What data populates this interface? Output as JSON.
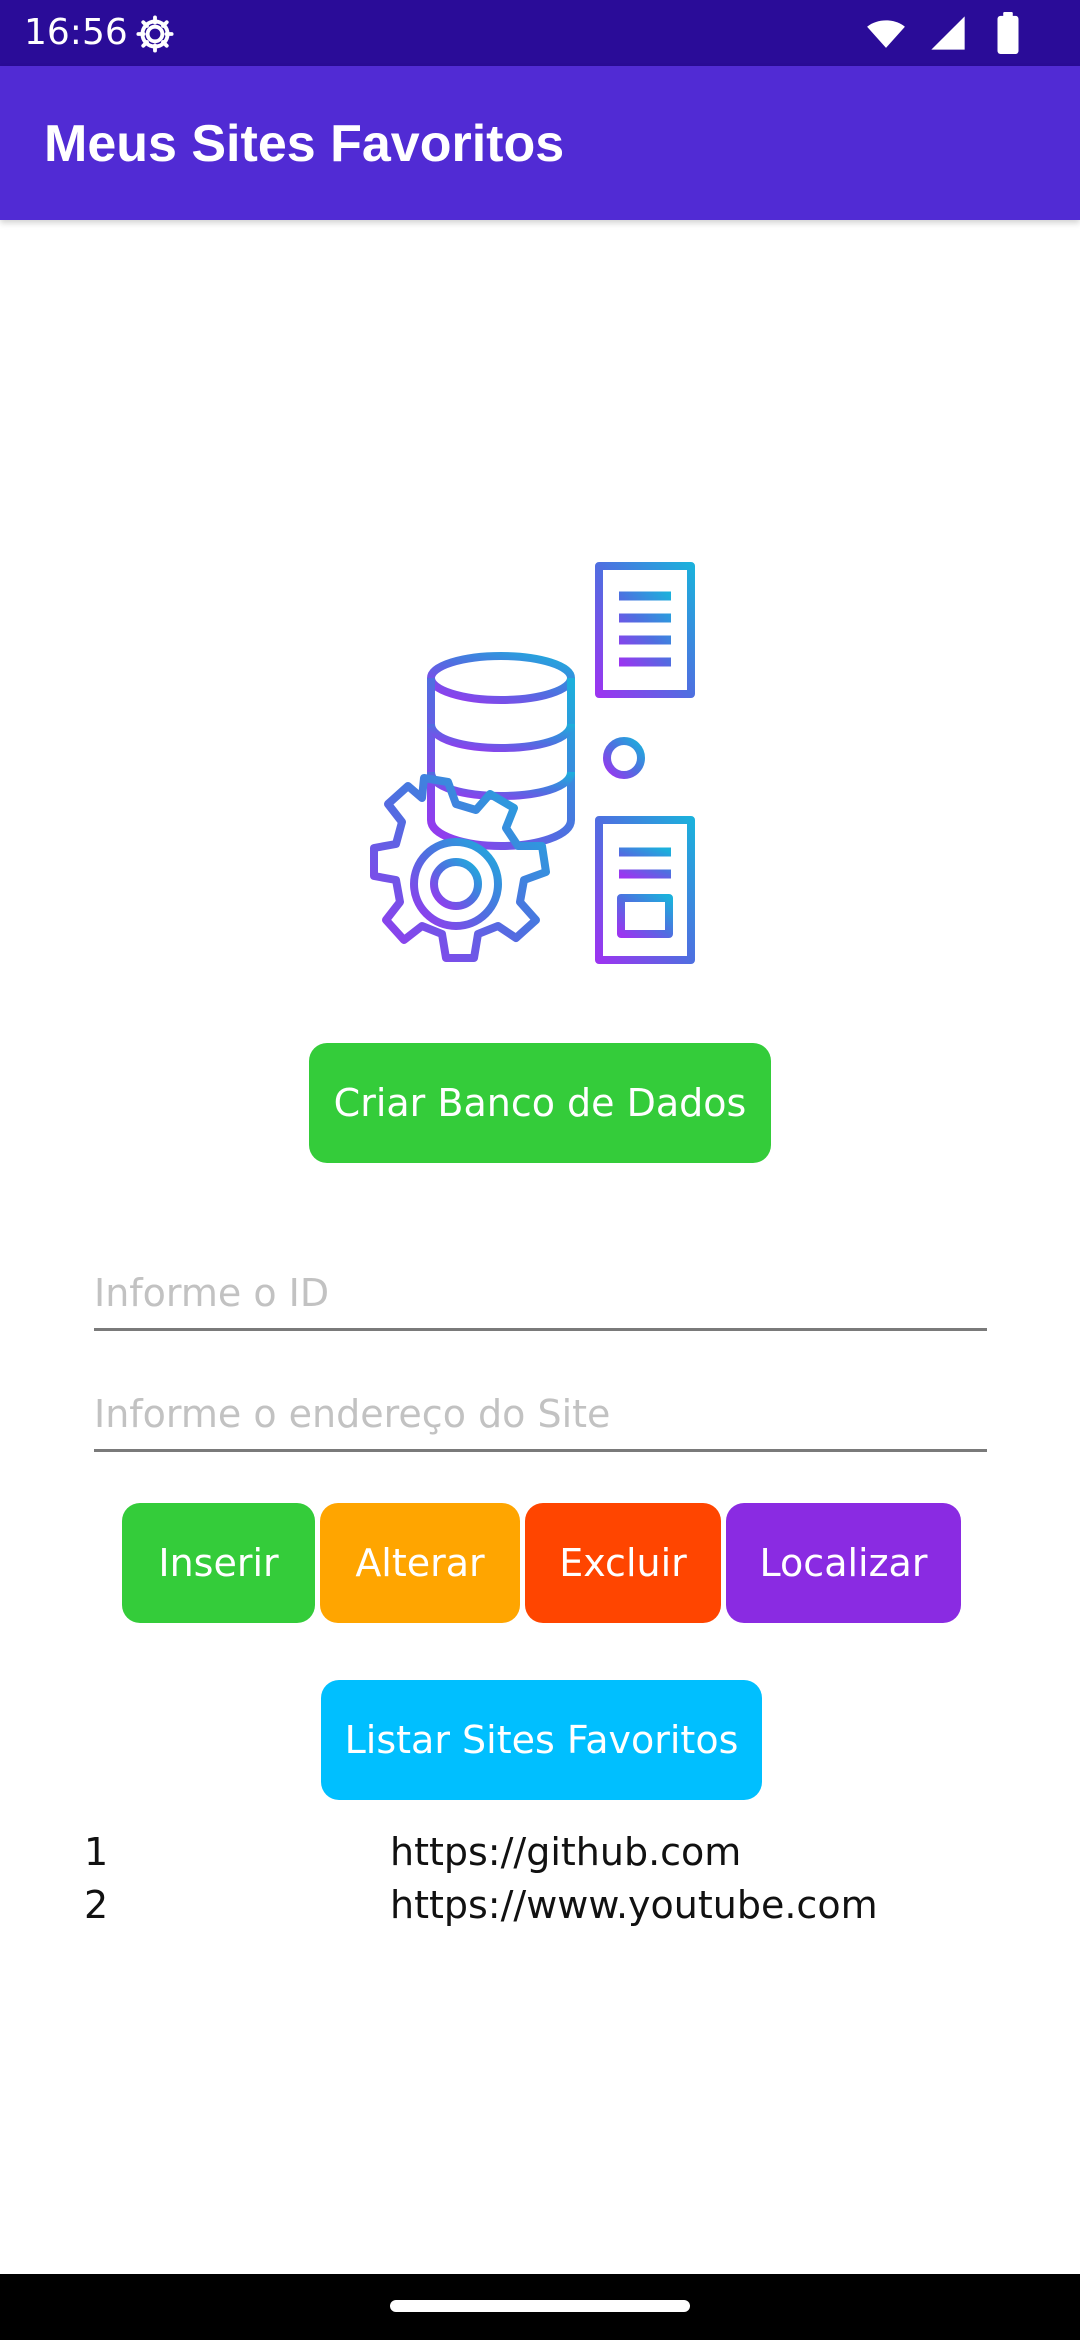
{
  "status_bar": {
    "time": "16:56",
    "icons": [
      "settings-gear-icon",
      "wifi-icon",
      "cellular-signal-icon",
      "battery-icon"
    ]
  },
  "app_bar": {
    "title": "Meus Sites Favoritos"
  },
  "hero": {
    "icon": "database-gear-documents-icon",
    "colors": [
      "#1cb0dc",
      "#4f6fe0",
      "#9b35f0"
    ]
  },
  "create_db_button": {
    "label": "Criar Banco de Dados",
    "color": "#34cc3a"
  },
  "fields": {
    "id": {
      "placeholder": "Informe o ID",
      "value": ""
    },
    "site": {
      "placeholder": "Informe o endereço do Site",
      "value": ""
    }
  },
  "actions": {
    "insert": {
      "label": "Inserir",
      "color": "#34cc3a"
    },
    "alter": {
      "label": "Alterar",
      "color": "#ffa500"
    },
    "delete": {
      "label": "Excluir",
      "color": "#ff4500"
    },
    "find": {
      "label": "Localizar",
      "color": "#8a2be2"
    }
  },
  "list_button": {
    "label": "Listar Sites Favoritos",
    "color": "#00bfff"
  },
  "sites": [
    {
      "id": "1",
      "url": "https://github.com"
    },
    {
      "id": "2",
      "url": "https://www.youtube.com"
    }
  ]
}
